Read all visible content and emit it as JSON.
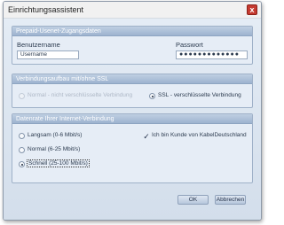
{
  "window": {
    "title": "Einrichtungsassistent",
    "close_glyph": "x"
  },
  "account": {
    "header": "Prepaid-Usenet-Zugangsdaten",
    "username_label": "Benutzername",
    "username_value": "Username",
    "password_label": "Passwort",
    "password_value": "●●●●●●●●●●●●●"
  },
  "connection": {
    "header": "Verbindungsaufbau mit/ohne SSL",
    "options": [
      {
        "label": "Normal - nicht verschlüsselte Verbindung",
        "selected": false,
        "enabled": false
      },
      {
        "label": "SSL - verschlüsselte Verbindung",
        "selected": true,
        "enabled": true
      }
    ]
  },
  "speed": {
    "header": "Datenrate Ihrer Internet-Verbindung",
    "options": [
      {
        "label": "Langsam (0-6 Mbit/s)",
        "selected": false
      },
      {
        "label": "Normal (6-25 Mbit/s)",
        "selected": false
      },
      {
        "label": "Schnell (25-100 Mbit/s)",
        "selected": true
      }
    ],
    "kabel_label": "Ich bin Kunde von KabelDeutschland",
    "kabel_checked": true,
    "check_glyph": "✓"
  },
  "buttons": {
    "ok": "OK",
    "cancel": "Abbrechen"
  }
}
